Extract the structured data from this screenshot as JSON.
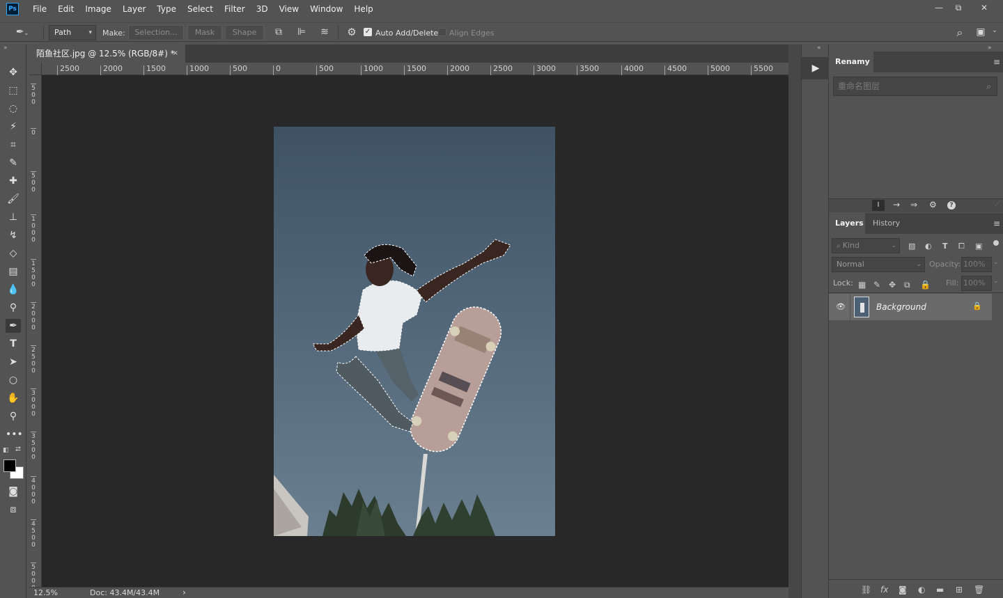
{
  "app": {
    "logo": "Ps"
  },
  "menu": [
    "File",
    "Edit",
    "Image",
    "Layer",
    "Type",
    "Select",
    "Filter",
    "3D",
    "View",
    "Window",
    "Help"
  ],
  "window_controls": {
    "minimize": "—",
    "restore": "⧉",
    "close": "✕"
  },
  "options": {
    "mode": "Path",
    "make_label": "Make:",
    "selection_btn": "Selection...",
    "mask_btn": "Mask",
    "shape_btn": "Shape",
    "auto_add_delete": "Auto Add/Delete",
    "auto_add_delete_checked": true,
    "align_edges": "Align Edges",
    "align_edges_checked": false
  },
  "document": {
    "tab_title": "陌鱼社区.jpg @ 12.5% (RGB/8#) *",
    "close": "×"
  },
  "ruler": {
    "h_labels": [
      "2500",
      "2000",
      "1500",
      "1000",
      "500",
      "0",
      "500",
      "1000",
      "1500",
      "2000",
      "2500",
      "3000",
      "3500",
      "4000",
      "4500",
      "5000",
      "5500"
    ],
    "v_labels": [
      "500",
      "0",
      "500",
      "1000",
      "1500",
      "2000",
      "2500",
      "3000",
      "3500",
      "4000",
      "4500",
      "5000"
    ]
  },
  "status": {
    "zoom": "12.5%",
    "doc": "Doc: 43.4M/43.4M",
    "arrow": "›"
  },
  "renamy": {
    "tab": "Renamy",
    "placeholder": "重命名图层"
  },
  "layers_panel": {
    "tabs": [
      "Layers",
      "History"
    ],
    "kind_label": "Kind",
    "blend_mode": "Normal",
    "opacity_label": "Opacity:",
    "opacity_value": "100%",
    "lock_label": "Lock:",
    "fill_label": "Fill:",
    "fill_value": "100%",
    "layers": [
      {
        "name": "Background",
        "visible": true,
        "locked": true
      }
    ]
  },
  "colors": {
    "ui_bg": "#535353",
    "canvas_bg": "#282828",
    "accent": "#31a8ff"
  }
}
